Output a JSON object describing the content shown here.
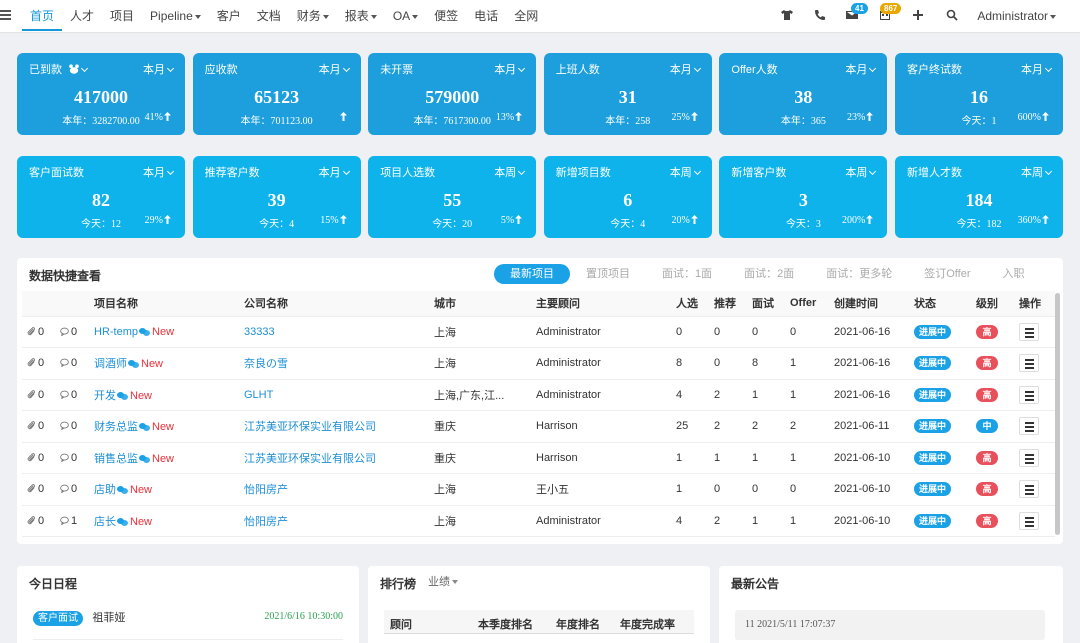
{
  "nav": {
    "items": [
      {
        "label": "首页",
        "active": true,
        "dropdown": false
      },
      {
        "label": "人才",
        "dropdown": false
      },
      {
        "label": "项目",
        "dropdown": false
      },
      {
        "label": "Pipeline",
        "dropdown": true
      },
      {
        "label": "客户",
        "dropdown": false
      },
      {
        "label": "文档",
        "dropdown": false
      },
      {
        "label": "财务",
        "dropdown": true
      },
      {
        "label": "报表",
        "dropdown": true
      },
      {
        "label": "OA",
        "dropdown": true
      },
      {
        "label": "便签",
        "dropdown": false
      },
      {
        "label": "电话",
        "dropdown": false
      },
      {
        "label": "全网",
        "dropdown": false
      }
    ],
    "mail_badge": "41",
    "calendar_badge": "867",
    "user": "Administrator",
    "colors": {
      "accent": "#1597d8",
      "mail_badge": "#1aa1e6",
      "calendar_badge": "#e8a800"
    }
  },
  "cards_row1": [
    {
      "title": "已到款",
      "period": "本月",
      "value": "417000",
      "sub": "本年：3282700.00",
      "pct": "41%",
      "has_icon": true
    },
    {
      "title": "应收款",
      "period": "本月",
      "value": "65123",
      "sub": "本年：701123.00",
      "pct": ""
    },
    {
      "title": "未开票",
      "period": "本月",
      "value": "579000",
      "sub": "本年：7617300.00",
      "pct": "13%"
    },
    {
      "title": "上班人数",
      "period": "本月",
      "value": "31",
      "sub": "本年：258",
      "pct": "25%"
    },
    {
      "title": "Offer人数",
      "period": "本月",
      "value": "38",
      "sub": "本年：365",
      "pct": "23%"
    },
    {
      "title": "客户终试数",
      "period": "本月",
      "value": "16",
      "sub": "今天：1",
      "pct": "600%"
    }
  ],
  "cards_row2": [
    {
      "title": "客户面试数",
      "period": "本月",
      "value": "82",
      "sub": "今天：12",
      "pct": "29%"
    },
    {
      "title": "推荐客户数",
      "period": "本月",
      "value": "39",
      "sub": "今天：4",
      "pct": "15%"
    },
    {
      "title": "项目人选数",
      "period": "本周",
      "value": "55",
      "sub": "今天：20",
      "pct": "5%"
    },
    {
      "title": "新增项目数",
      "period": "本周",
      "value": "6",
      "sub": "今天：4",
      "pct": "20%"
    },
    {
      "title": "新增客户数",
      "period": "本周",
      "value": "3",
      "sub": "今天：3",
      "pct": "200%"
    },
    {
      "title": "新增人才数",
      "period": "本周",
      "value": "184",
      "sub": "今天：182",
      "pct": "360%"
    }
  ],
  "quick": {
    "title": "数据快捷查看",
    "tabs": [
      "最新项目",
      "置顶项目",
      "面试：1面",
      "面试：2面",
      "面试：更多轮",
      "签订Offer",
      "入职"
    ],
    "columns": [
      "",
      "",
      "项目名称",
      "公司名称",
      "城市",
      "主要顾问",
      "人选",
      "推荐",
      "面试",
      "Offer",
      "创建时间",
      "状态",
      "级别",
      "操作"
    ],
    "rows": [
      {
        "att": "0",
        "cmt": "0",
        "project": "HR-temp",
        "company": "33333",
        "city": "上海",
        "consultant": "Administrator",
        "cand": "0",
        "rec": "0",
        "intv": "0",
        "offer": "0",
        "date": "2021-06-16",
        "status": "进展中",
        "level": "高",
        "new": "New"
      },
      {
        "att": "0",
        "cmt": "0",
        "project": "调酒师",
        "company": "奈良の雪",
        "city": "上海",
        "consultant": "Administrator",
        "cand": "8",
        "rec": "0",
        "intv": "8",
        "offer": "1",
        "date": "2021-06-16",
        "status": "进展中",
        "level": "高",
        "new": "New"
      },
      {
        "att": "0",
        "cmt": "0",
        "project": "开发",
        "company": "GLHT",
        "city": "上海,广东,江...",
        "consultant": "Administrator",
        "cand": "4",
        "rec": "2",
        "intv": "1",
        "offer": "1",
        "date": "2021-06-16",
        "status": "进展中",
        "level": "高",
        "new": "New"
      },
      {
        "att": "0",
        "cmt": "0",
        "project": "财务总监",
        "company": "江苏美亚环保实业有限公司",
        "city": "重庆",
        "consultant": "Harrison",
        "cand": "25",
        "rec": "2",
        "intv": "2",
        "offer": "2",
        "date": "2021-06-11",
        "status": "进展中",
        "level": "中",
        "new": "New"
      },
      {
        "att": "0",
        "cmt": "0",
        "project": "销售总监",
        "company": "江苏美亚环保实业有限公司",
        "city": "重庆",
        "consultant": "Harrison",
        "cand": "1",
        "rec": "1",
        "intv": "1",
        "offer": "1",
        "date": "2021-06-10",
        "status": "进展中",
        "level": "高",
        "new": "New"
      },
      {
        "att": "0",
        "cmt": "0",
        "project": "店助",
        "company": "怡阳房产",
        "city": "上海",
        "consultant": "王小五",
        "cand": "1",
        "rec": "0",
        "intv": "0",
        "offer": "0",
        "date": "2021-06-10",
        "status": "进展中",
        "level": "高",
        "new": "New"
      },
      {
        "att": "0",
        "cmt": "1",
        "project": "店长",
        "company": "怡阳房产",
        "city": "上海",
        "consultant": "Administrator",
        "cand": "4",
        "rec": "2",
        "intv": "1",
        "offer": "1",
        "date": "2021-06-10",
        "status": "进展中",
        "level": "高",
        "new": "New"
      }
    ],
    "colors": {
      "status": "#1aa1e6",
      "level_high": "#e8505b",
      "level_mid": "#1aa1e6"
    }
  },
  "schedule": {
    "title": "今日日程",
    "tag": "客户面试",
    "name": "祖菲娅",
    "time": "2021/6/16 10:30:00"
  },
  "ranking": {
    "title": "排行榜",
    "filter": "业绩",
    "columns": [
      "顾问",
      "本季度排名",
      "年度排名",
      "年度完成率"
    ]
  },
  "notice": {
    "title": "最新公告",
    "item": "11 2021/5/11 17:07:37"
  }
}
